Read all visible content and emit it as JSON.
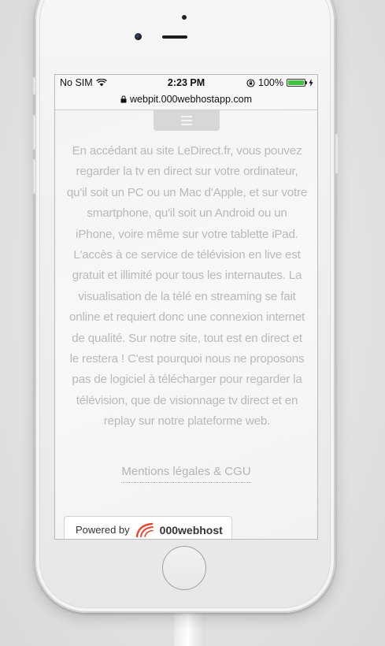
{
  "statusbar": {
    "carrier": "No SIM",
    "time": "2:23 PM",
    "battery": "100%",
    "battery_level": 1.0
  },
  "urlbar": {
    "url": "webpit.000webhostapp.com"
  },
  "content": {
    "intro": "En accédant au site LeDirect.fr, vous pouvez regarder la tv en direct sur votre ordinateur, qu'il soit un PC ou un Mac d'Apple, et sur votre smartphone, qu'il soit un Android ou un iPhone, voire même sur votre tablette iPad. L'accès à ce service de télévision en live est gratuit et illimité pour tous les internautes. La visualisation de la télé en streaming se fait online et requiert donc une connexion internet de qualité. Sur notre site, tout est en direct et le restera ! C'est pourquoi nous ne proposons pas de logiciel à télécharger pour regarder la télévision, que de visionnage tv direct et en replay sur notre plateforme web.",
    "legal_link": "Mentions légales & CGU"
  },
  "badge": {
    "prefix": "Powered by",
    "brand": "000webhost"
  },
  "colors": {
    "battery": "#3ec33e",
    "text": "#b9b9b9",
    "logo": "#e8452c"
  }
}
